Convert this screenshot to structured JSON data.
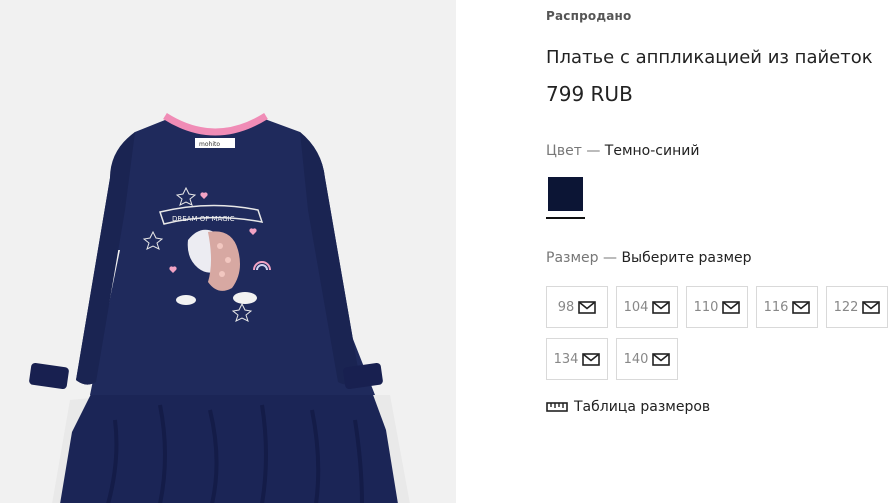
{
  "product": {
    "badge": "Распродано",
    "title": "Платье с аппликацией из пайеток",
    "price": "799 RUB",
    "image_alt": "Dark navy long-sleeve dress with a pink sequin unicorn print",
    "print_text": "DREAM OF MAGIC",
    "label_text": "mohito"
  },
  "color": {
    "label": "Цвет —",
    "value": "Темно-синий",
    "swatch_hex": "#0c1535"
  },
  "size": {
    "label": "Размер —",
    "value": "Выберите размер",
    "options": [
      "98",
      "104",
      "110",
      "116",
      "122",
      "134",
      "140"
    ],
    "option_icon": "envelope-icon"
  },
  "size_table": {
    "label": "Таблица размеров",
    "icon": "ruler-icon"
  }
}
